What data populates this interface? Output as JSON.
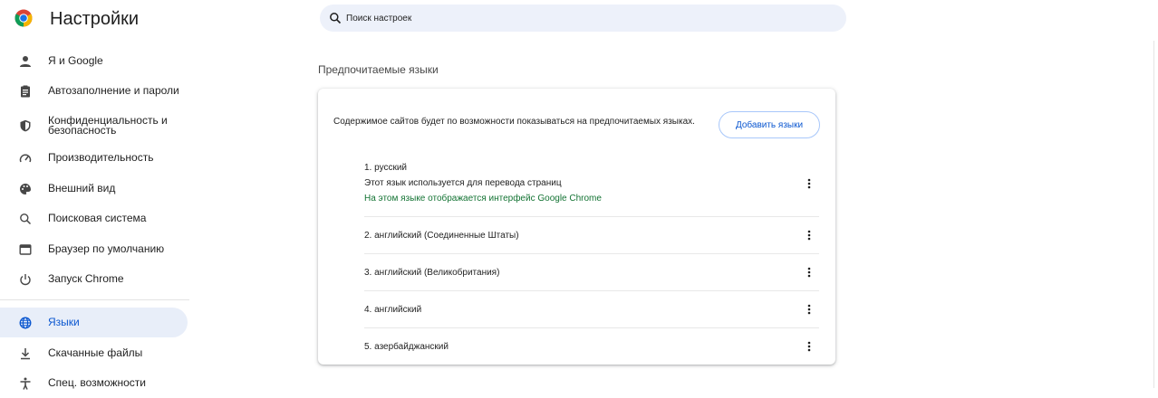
{
  "header": {
    "title": "Настройки",
    "search_placeholder": "Поиск настроек"
  },
  "sidebar": {
    "items": [
      {
        "label": "Я и Google",
        "icon": "person-icon"
      },
      {
        "label": "Автозаполнение и пароли",
        "icon": "clipboard-icon"
      },
      {
        "label": "Конфиденциальность и безопасность",
        "icon": "shield-icon"
      },
      {
        "label": "Производительность",
        "icon": "speedometer-icon"
      },
      {
        "label": "Внешний вид",
        "icon": "palette-icon"
      },
      {
        "label": "Поисковая система",
        "icon": "search-icon"
      },
      {
        "label": "Браузер по умолчанию",
        "icon": "browser-window-icon"
      },
      {
        "label": "Запуск Chrome",
        "icon": "power-icon"
      },
      {
        "label": "Языки",
        "icon": "globe-icon",
        "active": true
      },
      {
        "label": "Скачанные файлы",
        "icon": "download-icon"
      },
      {
        "label": "Спец. возможности",
        "icon": "accessibility-icon"
      }
    ]
  },
  "main": {
    "section_title": "Предпочитаемые языки",
    "card": {
      "description": "Содержимое сайтов будет по возможности показываться на предпочитаемых языках.",
      "add_button": "Добавить языки",
      "languages": [
        {
          "name": "1. русский",
          "note": "Этот язык используется для перевода страниц",
          "ui_note": "На этом языке отображается интерфейс Google Chrome"
        },
        {
          "name": "2. английский (Соединенные Штаты)"
        },
        {
          "name": "3. английский (Великобритания)"
        },
        {
          "name": "4. английский"
        },
        {
          "name": "5. азербайджанский"
        }
      ]
    }
  },
  "colors": {
    "accent": "#0b57d0",
    "active_bg": "#e8eef9",
    "search_bg": "#edf1fa",
    "ui_note_green": "#137333"
  }
}
